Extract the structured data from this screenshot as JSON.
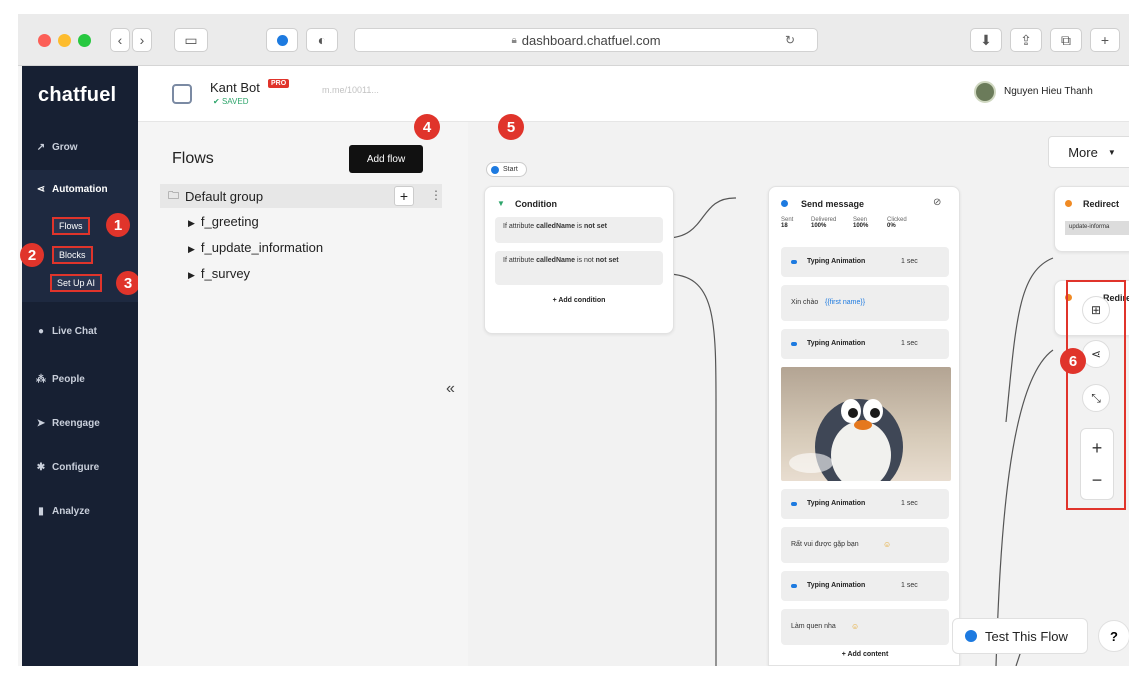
{
  "browser": {
    "url": "dashboard.chatfuel.com",
    "back_icon": "chevron-left-icon",
    "forward_icon": "chevron-right-icon"
  },
  "sidebar": {
    "logo": "chatfuel",
    "items": [
      {
        "label": "Grow",
        "icon": "trend-icon"
      },
      {
        "label": "Automation",
        "icon": "share-icon"
      },
      {
        "label": "Live Chat",
        "icon": "chat-icon"
      },
      {
        "label": "People",
        "icon": "people-icon"
      },
      {
        "label": "Reengage",
        "icon": "send-icon"
      },
      {
        "label": "Configure",
        "icon": "gear-icon"
      },
      {
        "label": "Analyze",
        "icon": "bars-icon"
      }
    ],
    "subitems": [
      "Flows",
      "Blocks",
      "Set Up AI"
    ]
  },
  "header": {
    "bot_name": "Kant Bot",
    "pro_badge": "PRO",
    "saved": "SAVED",
    "bot_link": "m.me/10011...",
    "user_name": "Nguyen Hieu Thanh"
  },
  "flows": {
    "title": "Flows",
    "tooltip": "Add flow",
    "group": "Default group",
    "items": [
      "f_greeting",
      "f_update_information",
      "f_survey"
    ],
    "collapse": "«"
  },
  "callouts": [
    "1",
    "2",
    "3",
    "4",
    "5",
    "6"
  ],
  "canvas": {
    "start": "Start",
    "more": "More",
    "condition": {
      "title": "Condition",
      "rows": [
        {
          "pre": "If attribute",
          "attr": "calledName",
          "rest": "is",
          "cond": "not set"
        },
        {
          "pre": "If attribute",
          "attr": "calledName",
          "rest": "is not",
          "cond": "not set"
        }
      ],
      "add": "+ Add condition"
    },
    "send": {
      "title": "Send message",
      "stats": [
        {
          "label": "Sent",
          "value": "18"
        },
        {
          "label": "Delivered",
          "value": "100%"
        },
        {
          "label": "Seen",
          "value": "100%"
        },
        {
          "label": "Clicked",
          "value": "0%"
        }
      ],
      "typing_label": "Typing Animation",
      "typing_time": "1 sec",
      "msg1_pre": "Xin chào",
      "msg1_var": "{{first name}}",
      "msg2": "Rất vui được gặp bạn",
      "msg3": "Làm quen nha",
      "add": "+ Add content"
    },
    "redirect": {
      "title": "Redirect",
      "tag": "update-informa",
      "title2": "Redirect"
    },
    "tools": [
      "add-block-icon",
      "share-icon",
      "collapse-icon"
    ],
    "zoom_in": "+",
    "zoom_out": "−",
    "test_button": "Test This Flow",
    "help": "?"
  },
  "colors": {
    "sidebar_bg": "#172033",
    "accent_red": "#e0342b",
    "link_blue": "#1d7ae0",
    "saved_green": "#2ea56b"
  }
}
